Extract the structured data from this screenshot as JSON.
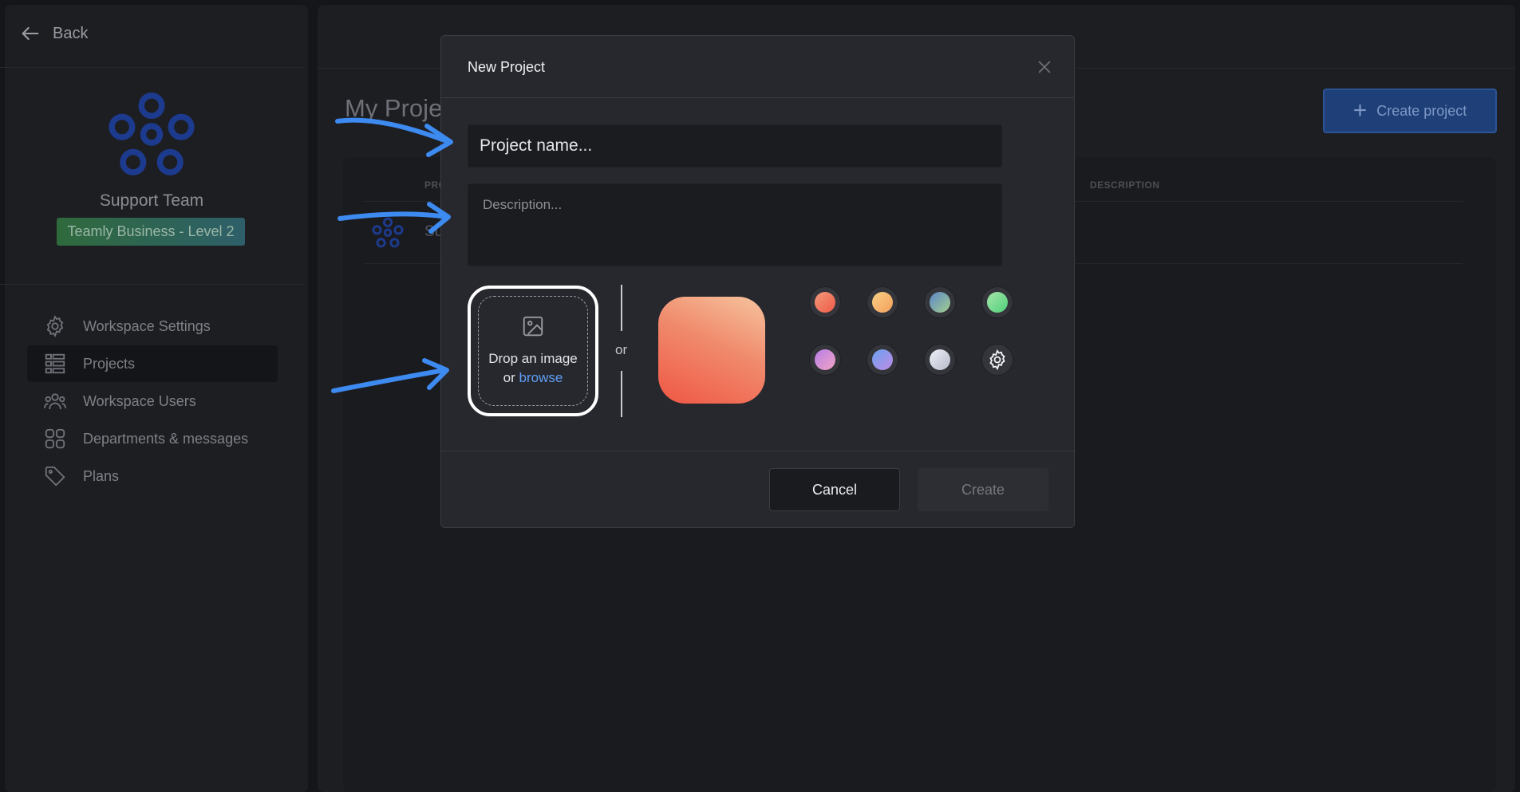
{
  "sidebar": {
    "back_label": "Back",
    "team_name": "Support Team",
    "plan_badge": "Teamly Business - Level 2",
    "nav": [
      {
        "label": "Workspace Settings",
        "icon": "gear-icon"
      },
      {
        "label": "Projects",
        "icon": "list-icon",
        "active": true
      },
      {
        "label": "Workspace Users",
        "icon": "users-icon"
      },
      {
        "label": "Departments & messages",
        "icon": "grid-icon"
      },
      {
        "label": "Plans",
        "icon": "tag-icon"
      }
    ]
  },
  "main": {
    "page_title": "My Proje",
    "create_project_label": "Create project",
    "table": {
      "col_name": "PRO",
      "col_description": "DESCRIPTION",
      "rows": [
        {
          "name": "Su"
        }
      ]
    }
  },
  "dialog": {
    "title": "New Project",
    "name_placeholder": "Project name...",
    "description_placeholder": "Description...",
    "drop_line1": "Drop an image",
    "drop_or": "or",
    "drop_browse": "browse",
    "or_label": "or",
    "preview_gradient": [
      "#ef5744",
      "#f6c49e"
    ],
    "swatches": [
      {
        "name": "red",
        "colors": [
          "#ee5a45",
          "#f39a7c"
        ]
      },
      {
        "name": "orange",
        "colors": [
          "#f5a05b",
          "#f7cf86"
        ]
      },
      {
        "name": "teal",
        "colors": [
          "#5c86c9",
          "#a4cf8c"
        ]
      },
      {
        "name": "green",
        "colors": [
          "#4fcf7a",
          "#a6e6a9"
        ]
      },
      {
        "name": "purple",
        "colors": [
          "#b77fe9",
          "#f2a3c2"
        ]
      },
      {
        "name": "blue",
        "colors": [
          "#6aa2f0",
          "#c08be4"
        ]
      },
      {
        "name": "silver",
        "colors": [
          "#b8bccb",
          "#eceef5"
        ]
      }
    ],
    "custom_icon": "gear-icon",
    "cancel_label": "Cancel",
    "create_label": "Create"
  },
  "colors": {
    "accent": "#2b5596",
    "arrow": "#3d8af0",
    "link": "#5f9ef6"
  }
}
